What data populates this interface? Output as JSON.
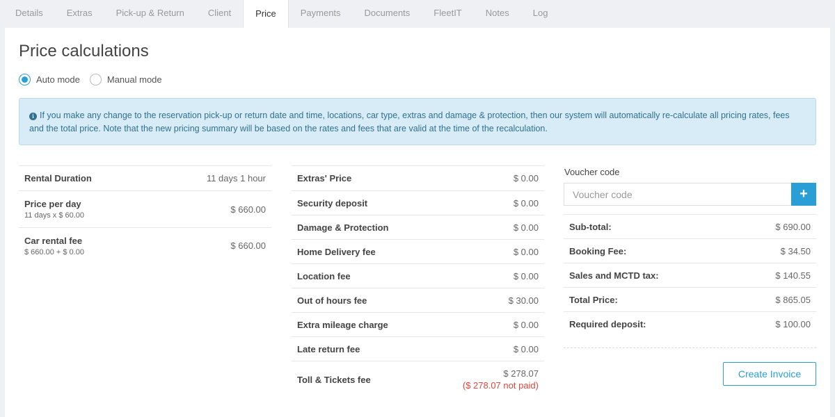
{
  "tabs": [
    "Details",
    "Extras",
    "Pick-up & Return",
    "Client",
    "Price",
    "Payments",
    "Documents",
    "FleetIT",
    "Notes",
    "Log"
  ],
  "active_tab": "Price",
  "page_title": "Price calculations",
  "modes": {
    "auto": "Auto mode",
    "manual": "Manual mode",
    "selected": "auto"
  },
  "alert": {
    "icon": "info-circle-icon",
    "text": "If you make any change to the reservation pick-up or return date and time, locations, car type, extras and damage & protection, then our system will automatically re-calculate all pricing rates, fees and the total price. Note that the new pricing summary will be based on the rates and fees that are valid at the time of the recalculation."
  },
  "left_table": {
    "rental_duration": {
      "label": "Rental Duration",
      "value": "11 days 1 hour"
    },
    "price_per_day": {
      "label": "Price per day",
      "sub": "11 days x $ 60.00",
      "value": "$ 660.00"
    },
    "car_rental_fee": {
      "label": "Car rental fee",
      "sub": "$ 660.00 + $ 0.00",
      "value": "$ 660.00"
    }
  },
  "middle_table": {
    "extras_price": {
      "label": "Extras' Price",
      "value": "$ 0.00"
    },
    "security_deposit": {
      "label": "Security deposit",
      "value": "$ 0.00"
    },
    "damage_protection": {
      "label": "Damage & Protection",
      "value": "$ 0.00"
    },
    "home_delivery": {
      "label": "Home Delivery fee",
      "value": "$ 0.00"
    },
    "location_fee": {
      "label": "Location fee",
      "value": "$ 0.00"
    },
    "out_of_hours": {
      "label": "Out of hours fee",
      "value": "$ 30.00"
    },
    "extra_mileage": {
      "label": "Extra mileage charge",
      "value": "$ 0.00"
    },
    "late_return": {
      "label": "Late return fee",
      "value": "$ 0.00"
    },
    "toll_tickets": {
      "label": "Toll & Tickets fee",
      "value": "$ 278.07",
      "unpaid": "($ 278.07 not paid)"
    }
  },
  "voucher": {
    "label": "Voucher code",
    "placeholder": "Voucher code",
    "add_button": "+"
  },
  "summary": {
    "subtotal": {
      "label": "Sub-total:",
      "value": "$ 690.00"
    },
    "booking_fee": {
      "label": "Booking Fee:",
      "value": "$ 34.50"
    },
    "sales_tax": {
      "label": "Sales and MCTD tax:",
      "value": "$ 140.55"
    },
    "total_price": {
      "label": "Total Price:",
      "value": "$ 865.05"
    },
    "required_deposit": {
      "label": "Required deposit:",
      "value": "$ 100.00"
    }
  },
  "create_invoice_label": "Create Invoice",
  "colors": {
    "accent": "#2a9fd6",
    "alert_bg": "#d7ecf6",
    "alert_text": "#31708f",
    "danger": "#e0473d"
  }
}
